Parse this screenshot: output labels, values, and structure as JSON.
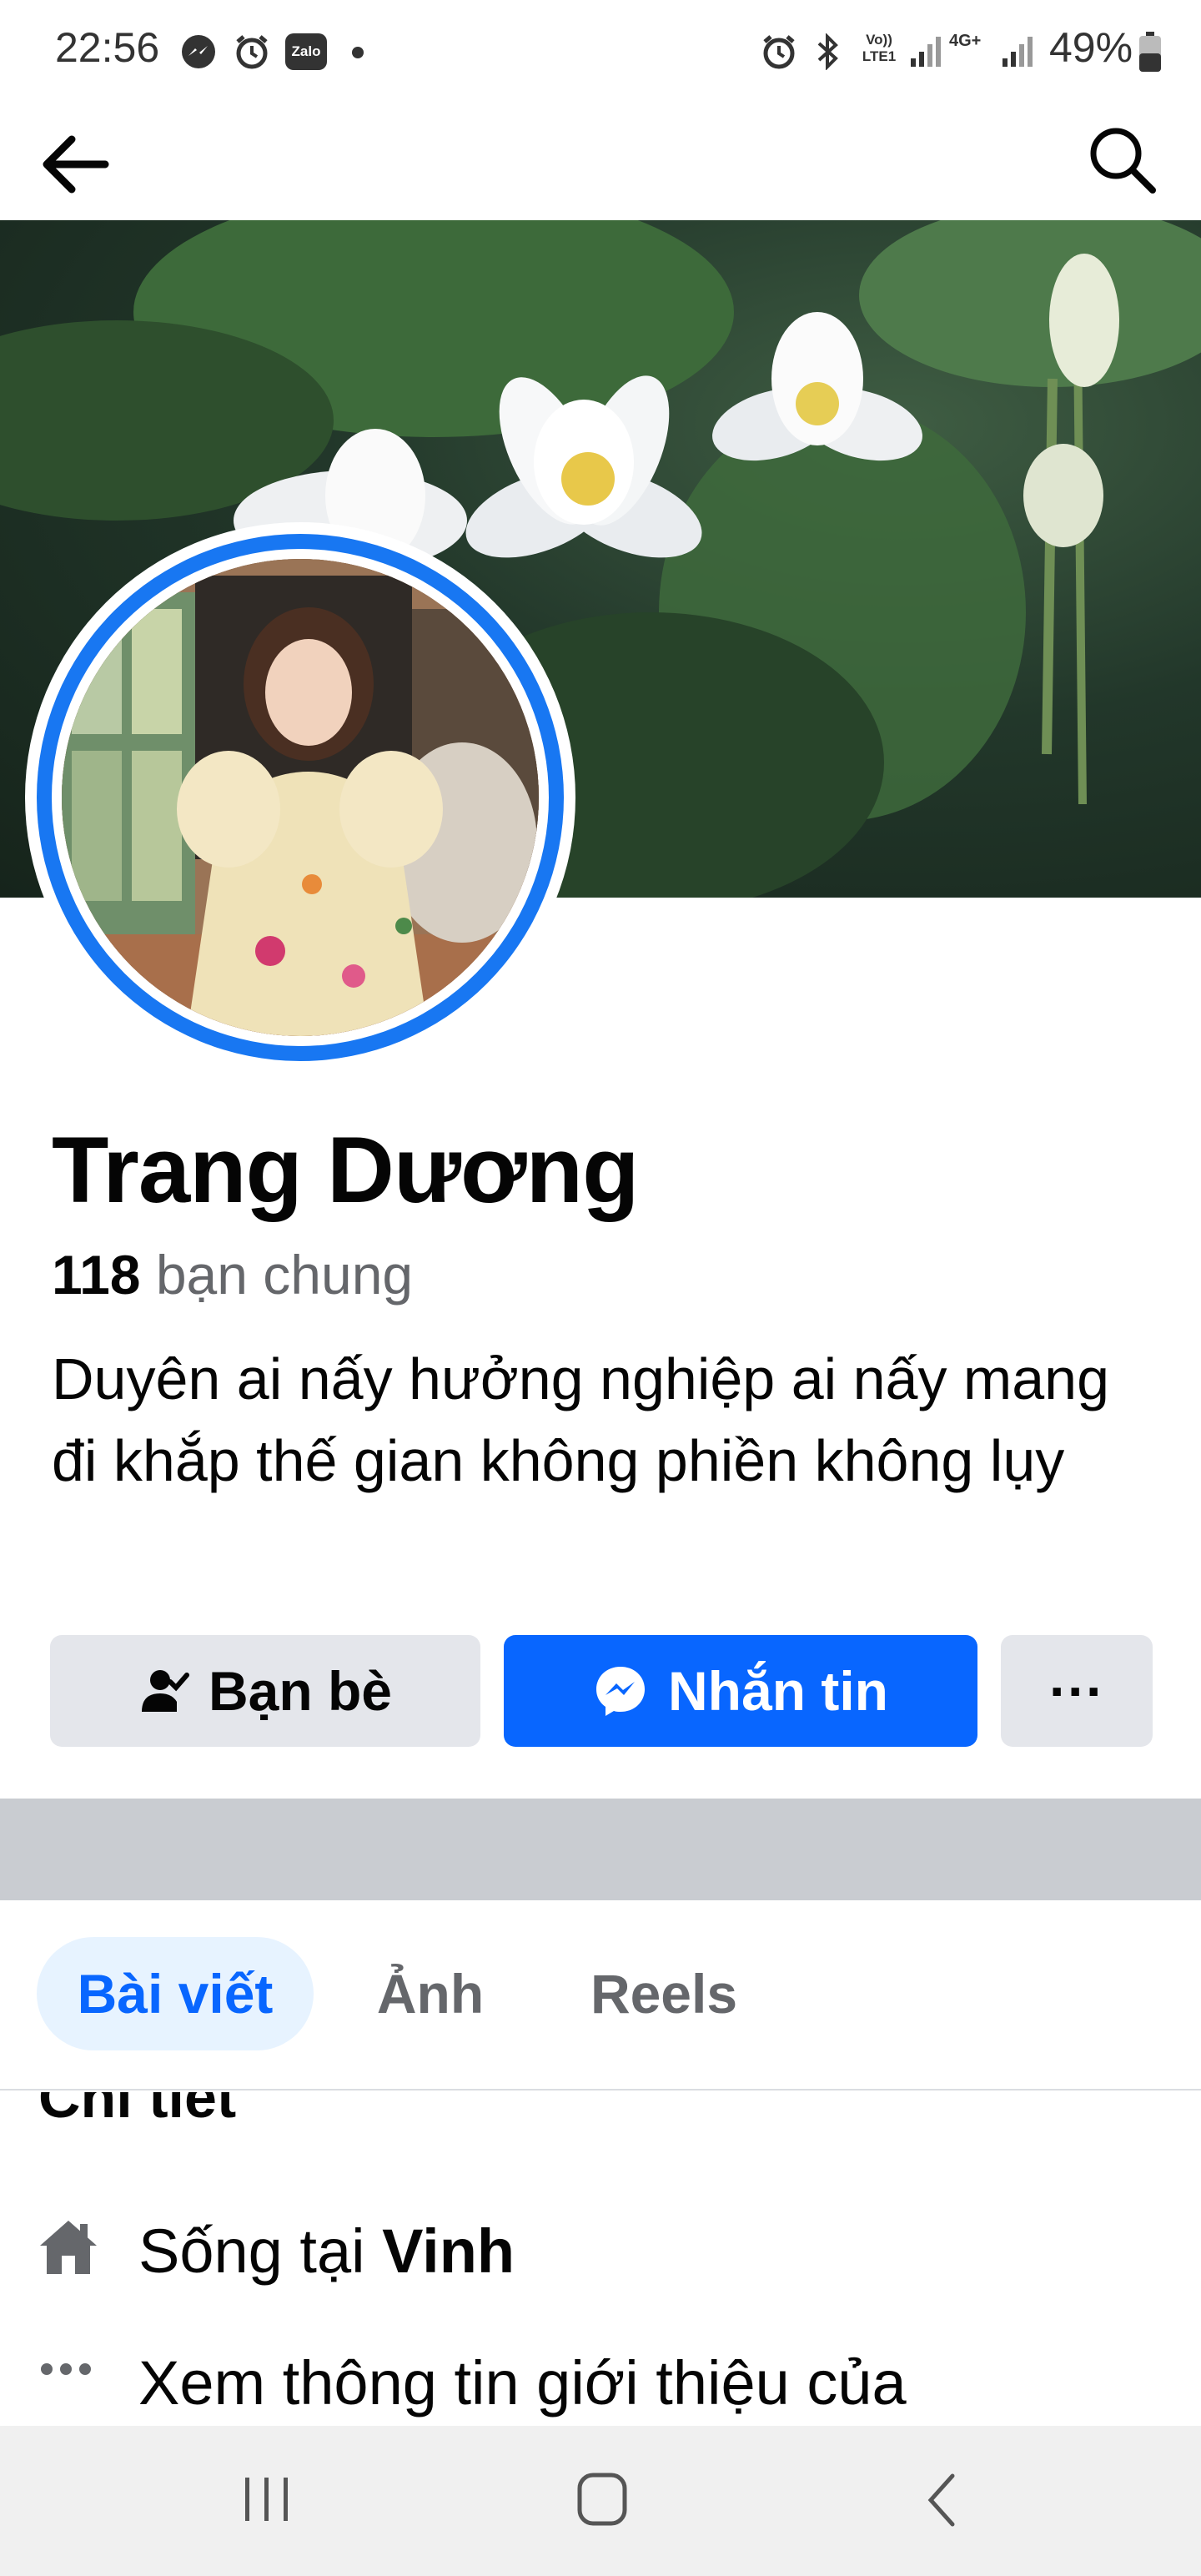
{
  "status_bar": {
    "time": "22:56",
    "left_icons": [
      "messenger-icon",
      "alarm-icon",
      "zalo-icon",
      "dot-icon"
    ],
    "zalo_label": "Zalo",
    "right_icons": [
      "alarm-icon",
      "bluetooth-icon",
      "volte-icon",
      "signal-icon",
      "4g-icon",
      "signal-icon",
      "battery-icon"
    ],
    "volte_label": "Vo))\nLTE1",
    "net_label": "4G+",
    "battery": "49%"
  },
  "top_nav": {
    "back_icon": "back-arrow-icon",
    "search_icon": "search-icon"
  },
  "profile": {
    "name": "Trang Dương",
    "mutual_count": "118",
    "mutual_label": "bạn chung",
    "bio": "Duyên ai nấy hưởng nghiệp ai nấy mang đi khắp thế gian không phiền không lụy"
  },
  "actions": {
    "friends_label": "Bạn bè",
    "message_label": "Nhắn tin",
    "more_label": "···"
  },
  "tabs": [
    {
      "label": "Bài viết",
      "active": true
    },
    {
      "label": "Ảnh",
      "active": false
    },
    {
      "label": "Reels",
      "active": false
    }
  ],
  "details": {
    "heading": "Chi tiết",
    "lives_prefix": "Sống tại",
    "lives_city": "Vinh",
    "see_more": "Xem thông tin giới thiệu của"
  },
  "colors": {
    "accent": "#0866ff",
    "secondary_button": "#e4e6eb",
    "active_tab_bg": "#e7f3ff"
  }
}
